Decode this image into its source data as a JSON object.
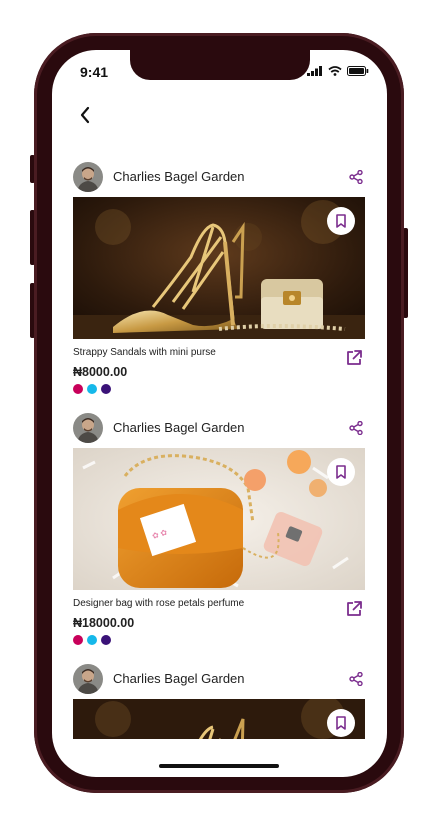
{
  "status": {
    "time": "9:41"
  },
  "colors": {
    "accent": "#7b2d8e",
    "swatch1": "#c8005a",
    "swatch2": "#15b8ea",
    "swatch3": "#3a1278"
  },
  "cards": [
    {
      "store": "Charlies Bagel Garden",
      "title": "Strappy Sandals with mini purse",
      "price": "₦8000.00"
    },
    {
      "store": "Charlies Bagel Garden",
      "title": "Designer bag with rose petals perfume",
      "price": "₦18000.00"
    },
    {
      "store": "Charlies Bagel Garden"
    }
  ]
}
